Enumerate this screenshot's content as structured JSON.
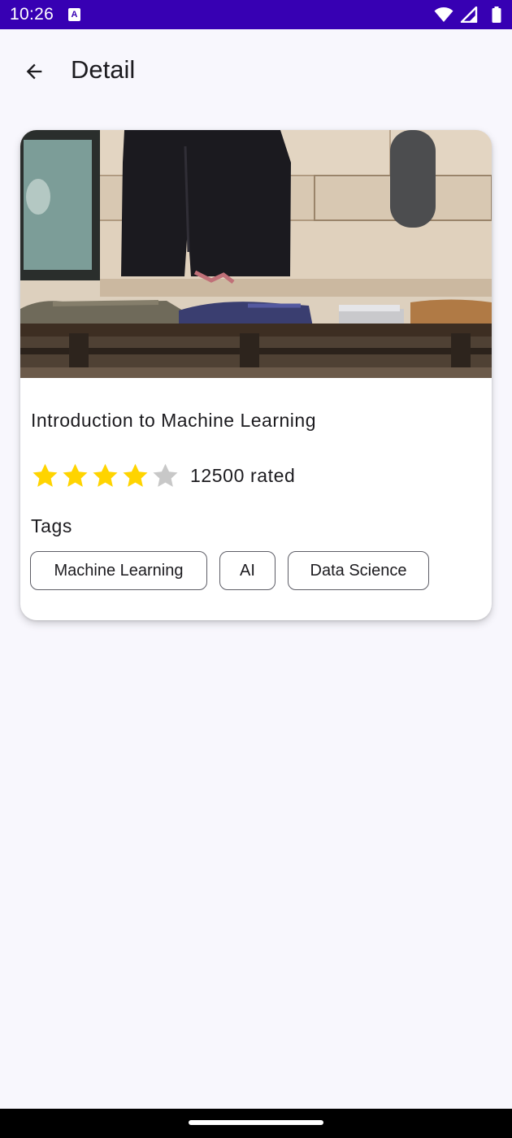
{
  "status_bar": {
    "time": "10:26",
    "notification_icon_letter": "A",
    "icons": [
      "wifi-icon",
      "cellular-signal-icon",
      "battery-icon"
    ],
    "background_color": "#3700b3"
  },
  "top_bar": {
    "back_icon": "arrow-back-icon",
    "title": "Detail"
  },
  "course": {
    "title": "Introduction to Machine Learning",
    "rating": 4,
    "rating_max": 5,
    "rating_text": "12500 rated",
    "star_color_filled": "#ffd400",
    "star_color_empty": "#c8c8c8",
    "tags_label": "Tags",
    "tags": [
      "Machine Learning",
      "AI",
      "Data Science"
    ]
  }
}
